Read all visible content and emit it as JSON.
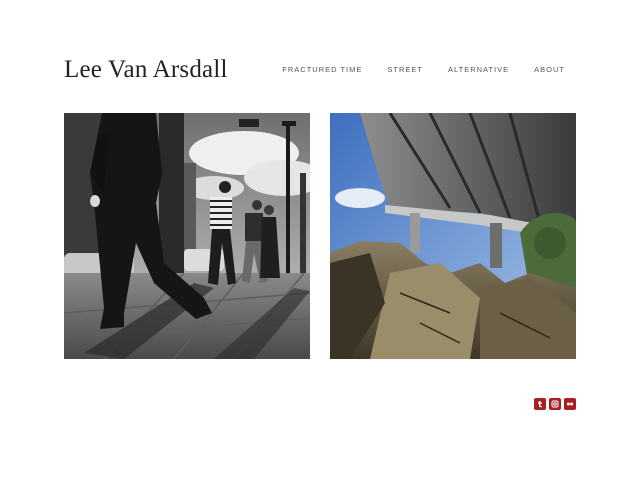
{
  "site": {
    "title": "Lee Van Arsdall"
  },
  "nav": {
    "items": [
      {
        "label": "FRACTURED TIME"
      },
      {
        "label": "STREET"
      },
      {
        "label": "ALTERNATIVE"
      },
      {
        "label": "ABOUT"
      }
    ]
  },
  "gallery": {
    "photos": [
      {
        "icon": "street-photo-pedestrians-bw"
      },
      {
        "icon": "bridge-underpass-rocks-photo"
      }
    ]
  },
  "social": {
    "accent": "#a82024",
    "icons": [
      "tumblr-icon",
      "instagram-icon",
      "flickr-icon"
    ]
  }
}
